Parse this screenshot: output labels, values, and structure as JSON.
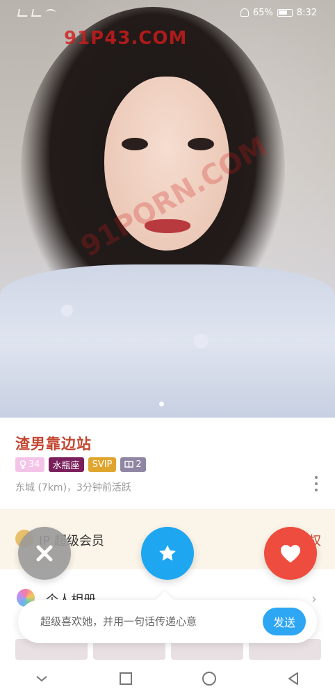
{
  "status_bar": {
    "battery": "65%",
    "time": "8:32"
  },
  "watermark": {
    "text": "91P43.COM",
    "diagonal": "91PORN.COM"
  },
  "profile": {
    "name": "渣男靠边站",
    "age": "34",
    "zodiac": "水瓶座",
    "membership": "SVIP",
    "album_count": "2",
    "location": "东城 (7km)，3分钟前活跃"
  },
  "svip_banner": {
    "text": "IP 超级会员",
    "right_text": "权"
  },
  "album_row": {
    "label": "个人相册"
  },
  "message": {
    "placeholder": "超级喜欢她，并用一句话传递心意",
    "send_label": "发送"
  },
  "colors": {
    "name": "#c4452f",
    "star": "#1ea7f0",
    "like": "#ee4c3e",
    "dislike": "#9a9a9a",
    "send": "#2da6f3"
  },
  "icons": {
    "dislike": "close-icon",
    "star": "star-icon",
    "like": "heart-icon",
    "more": "more-vertical-icon",
    "age": "female-icon",
    "album": "book-icon"
  }
}
